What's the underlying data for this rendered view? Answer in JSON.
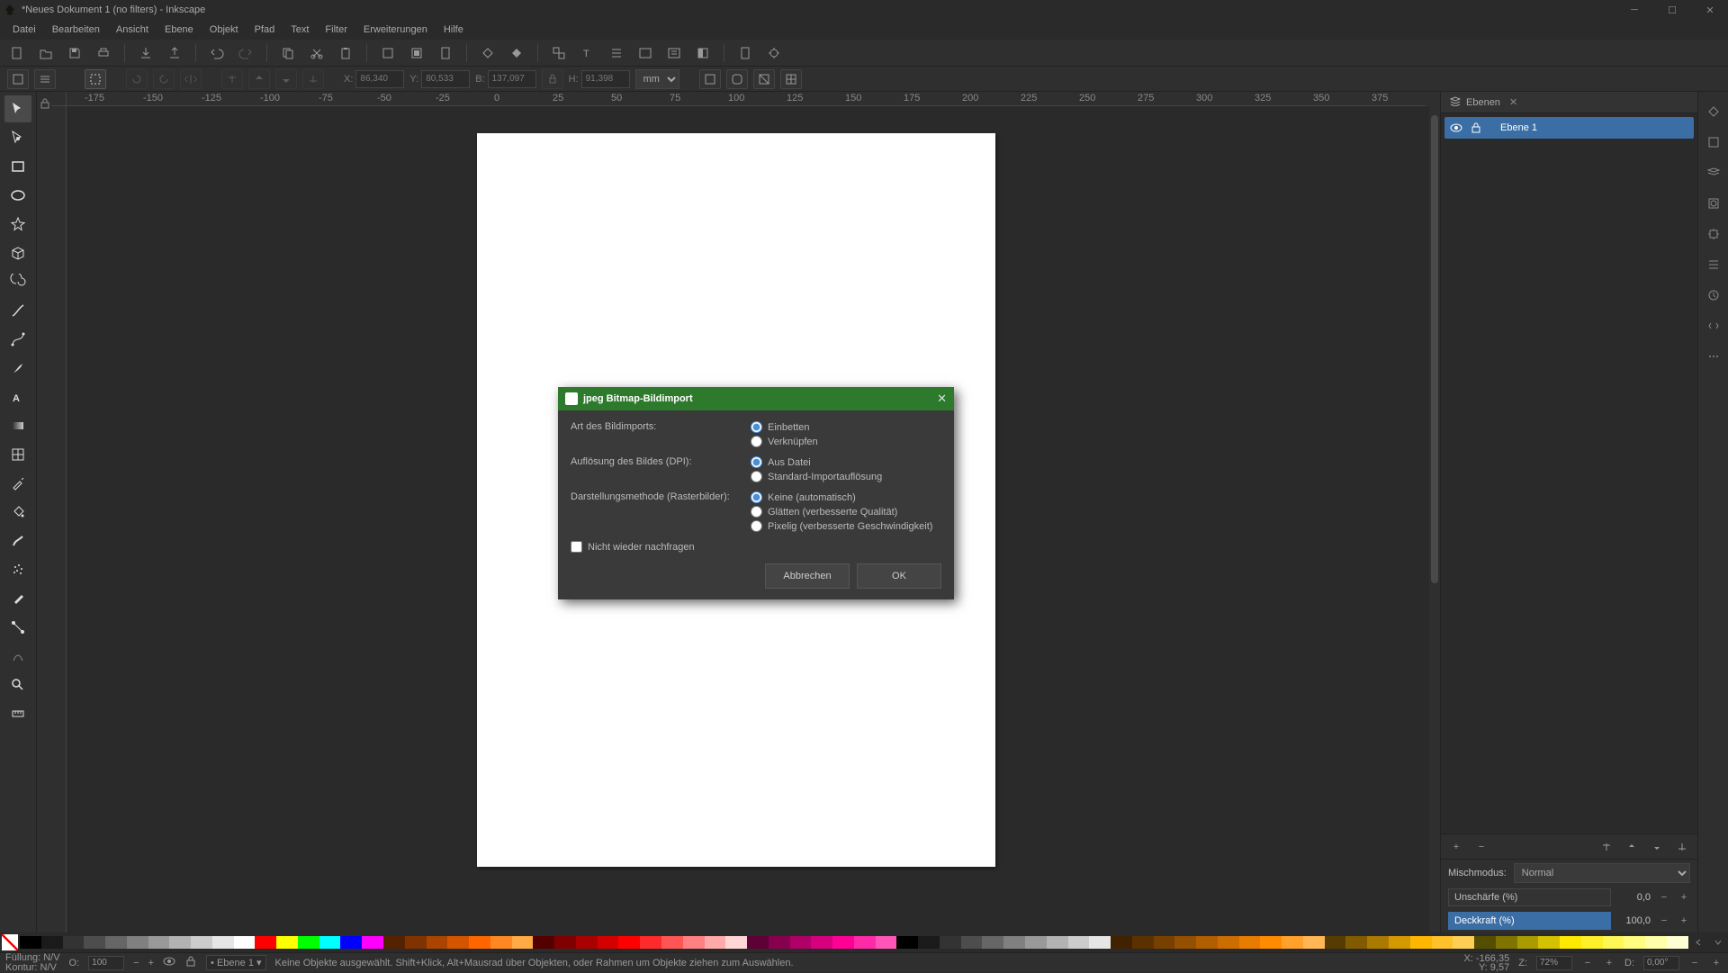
{
  "window": {
    "title": "*Neues Dokument 1 (no filters) - Inkscape"
  },
  "menu": [
    "Datei",
    "Bearbeiten",
    "Ansicht",
    "Ebene",
    "Objekt",
    "Pfad",
    "Text",
    "Filter",
    "Erweiterungen",
    "Hilfe"
  ],
  "ctx": {
    "x_label": "X:",
    "x": "86,340",
    "y_label": "Y:",
    "y": "80,533",
    "w_label": "B:",
    "w": "137,097",
    "h_label": "H:",
    "h": "91,398",
    "unit": "mm"
  },
  "layers": {
    "tab": "Ebenen",
    "items": [
      {
        "name": "Ebene 1"
      }
    ],
    "blend_label": "Mischmodus:",
    "blend_value": "Normal",
    "blur_label": "Unschärfe (%)",
    "blur_value": "0,0",
    "opacity_label": "Deckkraft (%)",
    "opacity_value": "100,0"
  },
  "dialog": {
    "title": "jpeg Bitmap-Bildimport",
    "import_type_label": "Art des Bildimports:",
    "import_type_opts": [
      "Einbetten",
      "Verknüpfen"
    ],
    "dpi_label": "Auflösung des Bildes (DPI):",
    "dpi_opts": [
      "Aus Datei",
      "Standard-Importauflösung"
    ],
    "render_label": "Darstellungsmethode (Rasterbilder):",
    "render_opts": [
      "Keine (automatisch)",
      "Glätten (verbesserte Qualität)",
      "Pixelig (verbesserte Geschwindigkeit)"
    ],
    "dont_ask": "Nicht wieder nachfragen",
    "cancel": "Abbrechen",
    "ok": "OK"
  },
  "status": {
    "fill_label": "Füllung:",
    "fill_value": "N/V",
    "stroke_label": "Kontur:",
    "stroke_value": "N/V",
    "o_label": "O:",
    "o_value": "100",
    "layer": "Ebene 1",
    "hint": "Keine Objekte ausgewählt. Shift+Klick, Alt+Mausrad über Objekten, oder Rahmen um Objekte ziehen zum Auswählen.",
    "x_label": "X:",
    "x": "-166,35",
    "y_label": "Y:",
    "y": "9,57",
    "z_label": "Z:",
    "z": "72%",
    "d_label": "D:",
    "d": "0,00°"
  },
  "ruler_marks": [
    {
      "pos": 20,
      "label": "-175"
    },
    {
      "pos": 85,
      "label": "-150"
    },
    {
      "pos": 150,
      "label": "-125"
    },
    {
      "pos": 215,
      "label": "-100"
    },
    {
      "pos": 280,
      "label": "-75"
    },
    {
      "pos": 345,
      "label": "-50"
    },
    {
      "pos": 410,
      "label": "-25"
    },
    {
      "pos": 475,
      "label": "0"
    },
    {
      "pos": 540,
      "label": "25"
    },
    {
      "pos": 605,
      "label": "50"
    },
    {
      "pos": 670,
      "label": "75"
    },
    {
      "pos": 735,
      "label": "100"
    },
    {
      "pos": 800,
      "label": "125"
    },
    {
      "pos": 865,
      "label": "150"
    },
    {
      "pos": 930,
      "label": "175"
    },
    {
      "pos": 995,
      "label": "200"
    },
    {
      "pos": 1060,
      "label": "225"
    },
    {
      "pos": 1125,
      "label": "250"
    },
    {
      "pos": 1190,
      "label": "275"
    },
    {
      "pos": 1255,
      "label": "300"
    },
    {
      "pos": 1320,
      "label": "325"
    },
    {
      "pos": 1385,
      "label": "350"
    },
    {
      "pos": 1450,
      "label": "375"
    }
  ],
  "palette_colors": [
    "#000000",
    "#1a1a1a",
    "#333333",
    "#4d4d4d",
    "#666666",
    "#808080",
    "#999999",
    "#b3b3b3",
    "#cccccc",
    "#e6e6e6",
    "#ffffff",
    "#ff0000",
    "#ffff00",
    "#00ff00",
    "#00ffff",
    "#0000ff",
    "#ff00ff",
    "#552200",
    "#803300",
    "#aa4400",
    "#d45500",
    "#ff6600",
    "#ff8822",
    "#ffaa44",
    "#550000",
    "#800000",
    "#aa0000",
    "#d40000",
    "#ff0000",
    "#ff2a2a",
    "#ff5555",
    "#ff8080",
    "#ffaaaa",
    "#ffd5d5",
    "#5f0037",
    "#87004f",
    "#ae0066",
    "#d6007e",
    "#ff0096",
    "#ff2aa7",
    "#ff55b8",
    "#000000",
    "#1a1a1a",
    "#333333",
    "#4d4d4d",
    "#666666",
    "#808080",
    "#999999",
    "#b3b3b3",
    "#cccccc",
    "#e6e6e6",
    "#402200",
    "#5c3100",
    "#784000",
    "#944f00",
    "#b05e00",
    "#cc6d00",
    "#e87c00",
    "#ff8b00",
    "#ffa12a",
    "#ffb755",
    "#553c00",
    "#805b00",
    "#aa7900",
    "#d49800",
    "#ffb600",
    "#ffc22a",
    "#ffcf55",
    "#554d00",
    "#807400",
    "#aa9b00",
    "#d4c200",
    "#ffe900",
    "#fff02a",
    "#fff755",
    "#fffc80",
    "#ffffaa",
    "#ffffd5"
  ]
}
